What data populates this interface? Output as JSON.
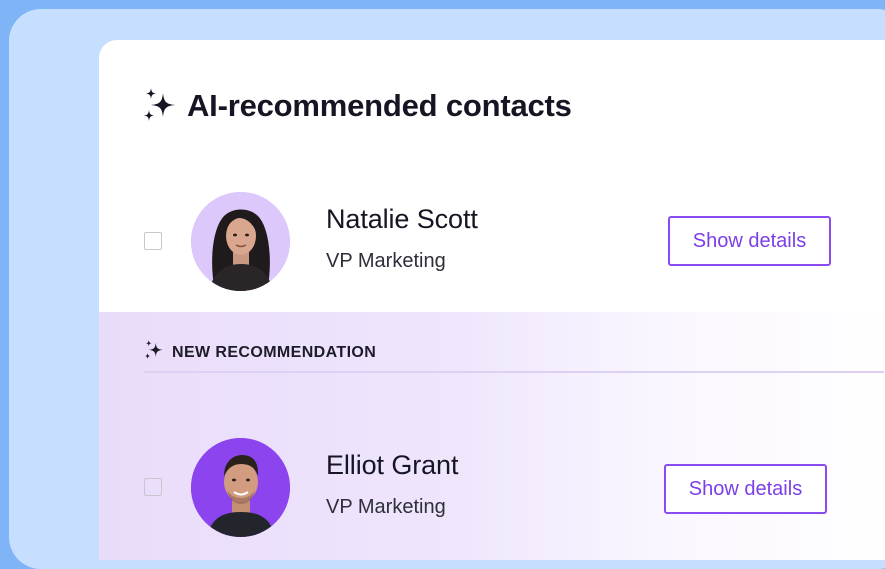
{
  "panel": {
    "title": "AI-recommended contacts"
  },
  "contacts": [
    {
      "name": "Natalie Scott",
      "role": "VP Marketing",
      "button_label": "Show details",
      "avatar_bg": "#dcc8fb"
    },
    {
      "name": "Elliot Grant",
      "role": "VP Marketing",
      "button_label": "Show details",
      "avatar_bg": "#8b44ee"
    }
  ],
  "recommendation": {
    "label": "NEW RECOMMENDATION"
  },
  "colors": {
    "accent": "#8a4bf0",
    "page_bg": "#7fb4f7",
    "backdrop": "#c7dfff",
    "highlight_row": "#e9dcfb"
  }
}
